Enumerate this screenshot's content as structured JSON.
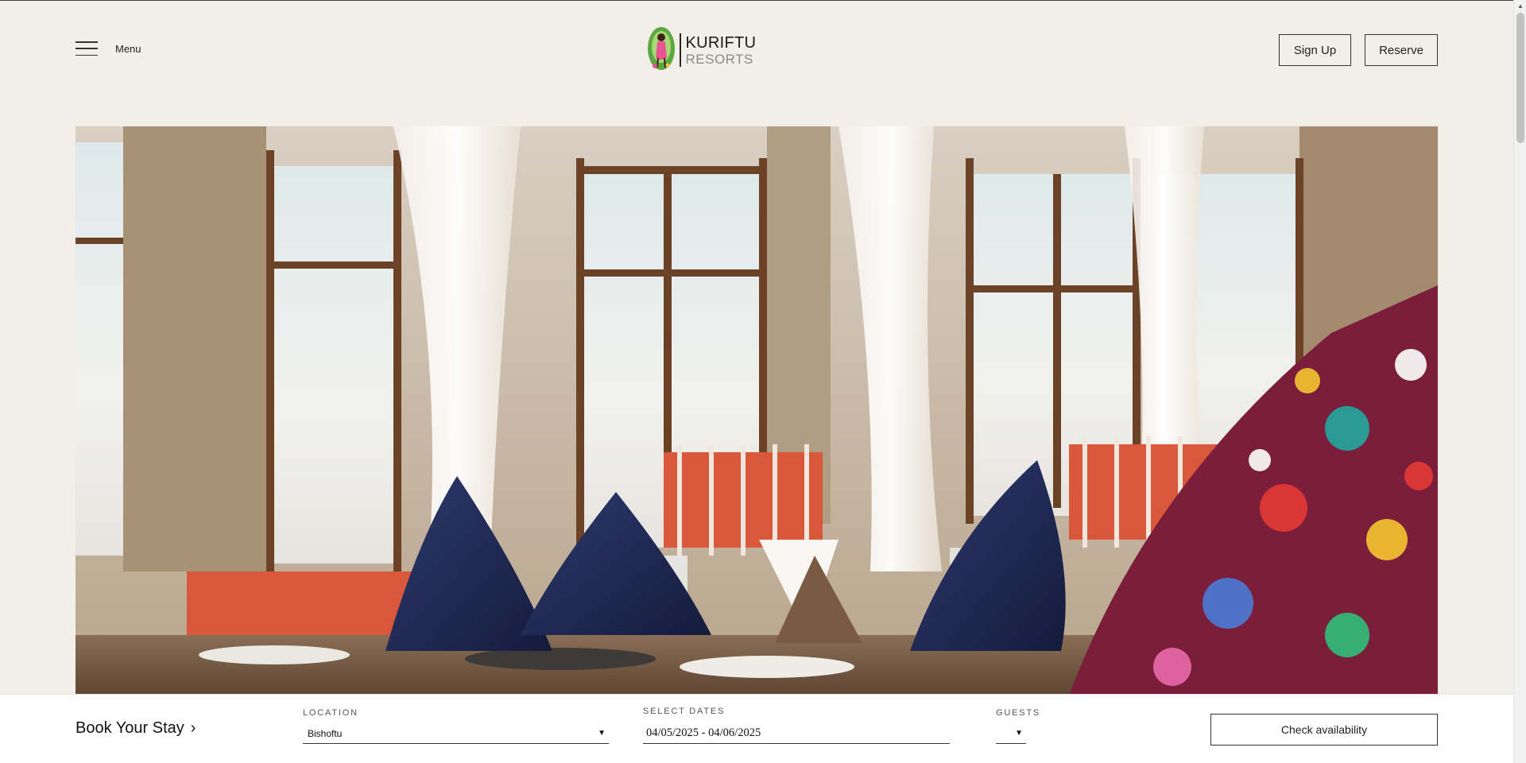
{
  "header": {
    "menu_label": "Menu",
    "logo": {
      "line1": "KURIFTU",
      "line2": "RESORTS"
    },
    "signup_label": "Sign Up",
    "reserve_label": "Reserve"
  },
  "hero": {
    "icon": "restaurant-photo"
  },
  "booking": {
    "title": "Book Your Stay",
    "title_chevron": "›",
    "location": {
      "label": "LOCATION",
      "value": "Bishoftu"
    },
    "dates": {
      "label": "SELECT DATES",
      "value": "04/05/2025 - 04/06/2025"
    },
    "guests": {
      "label": "GUESTS",
      "value": ""
    },
    "check_label": "Check availability"
  },
  "colors": {
    "page_bg": "#f2eee8",
    "bar_bg": "#ffffff",
    "text": "#1a1a1a"
  }
}
